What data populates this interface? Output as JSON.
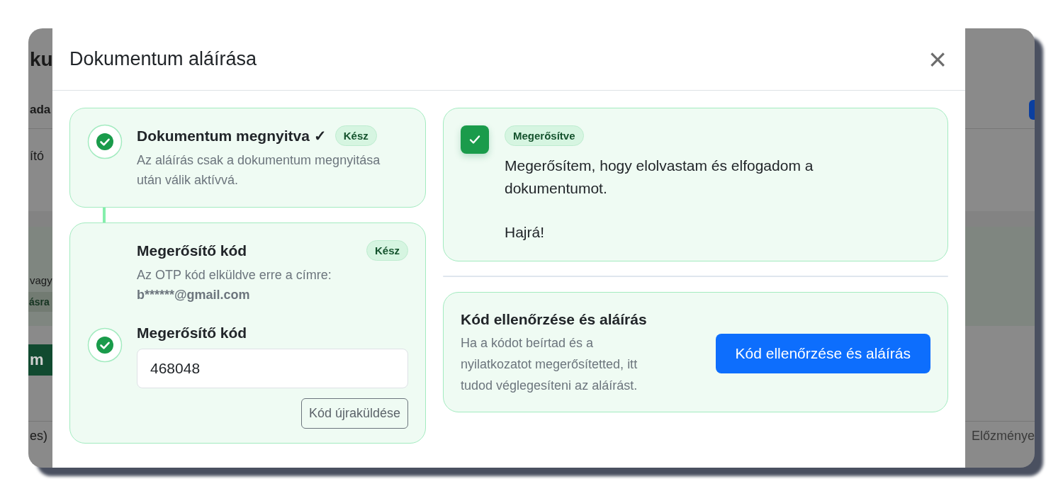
{
  "background_page": {
    "left_fragments": [
      "ku",
      "ada",
      "ító",
      "vagy",
      "ásra",
      "m",
      "es)"
    ],
    "right_fragments": [
      "Előzménye"
    ]
  },
  "modal": {
    "title": "Dokumentum aláírása",
    "close": "×"
  },
  "steps": [
    {
      "kind": "status",
      "title": "Dokumentum megnyitva ✓",
      "badge": "Kész",
      "description": "Az aláírás csak a dokumentum megnyitása után válik aktívvá.",
      "done": true
    },
    {
      "kind": "otp",
      "title": "Megerősítő kód",
      "badge": "Kész",
      "description": "Az OTP kód elküldve erre a címre:",
      "email": "b******@gmail.com",
      "field_label": "Megerősítő kód",
      "value": "468048",
      "resend_button": "Kód újraküldése",
      "done": true
    }
  ],
  "confirmation": {
    "badge": "Megerősítve",
    "checked": true,
    "paragraphs": [
      "Megerősítem, hogy elolvastam és elfogadom a dokumentumot.",
      "Hajrá!"
    ]
  },
  "submit": {
    "title": "Kód ellenőrzése és aláírás",
    "description": "Ha a kódot beírtad és a nyilatkozatot megerősítetted, itt tudod véglegesíteni az aláírást.",
    "button": "Kód ellenőrzése és aláírás"
  }
}
